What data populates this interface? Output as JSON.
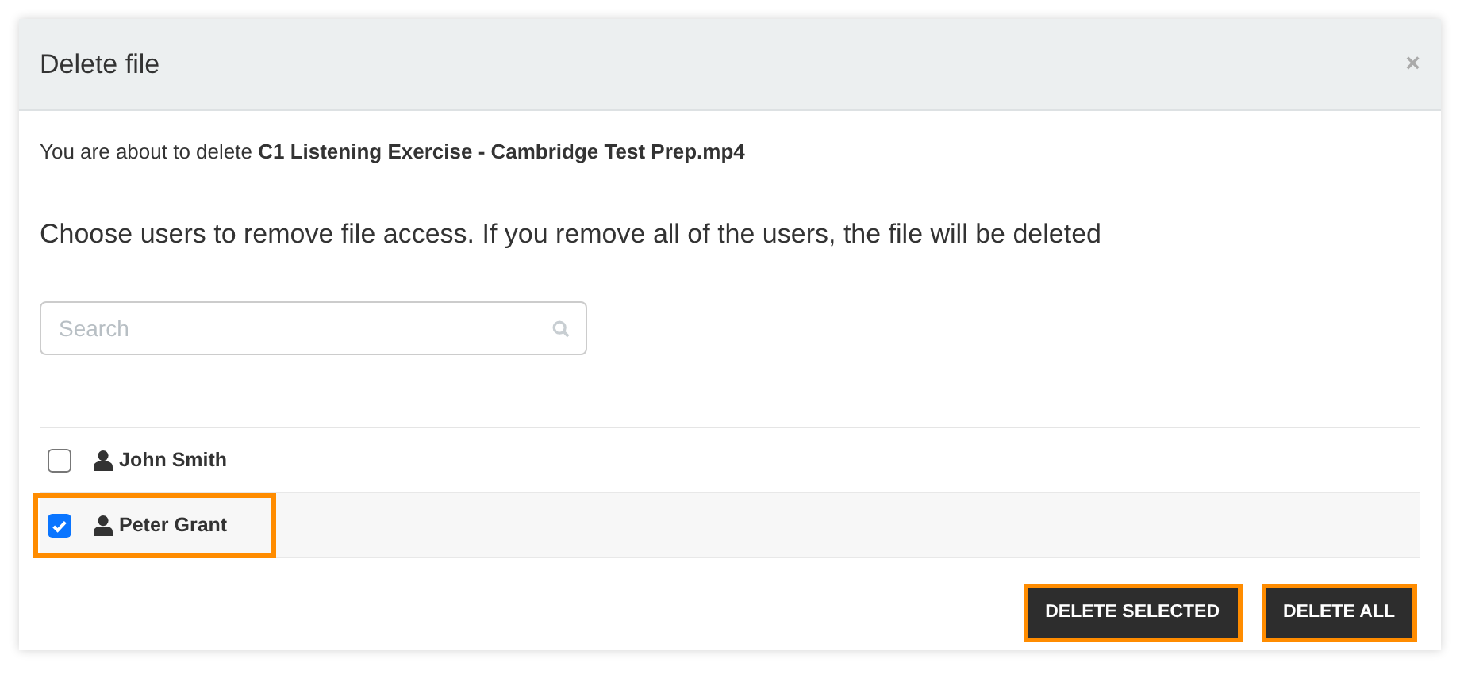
{
  "dialog": {
    "title": "Delete file",
    "close": "×"
  },
  "intro": "You are about to delete **C1 Listening Exercise - Cambridge Test Prep.mp4**",
  "instruction": "Choose users to remove file access. If you remove all of the users, the file will be deleted",
  "search": {
    "placeholder": "Search"
  },
  "users": [
    {
      "name": "John Smith",
      "checked": false,
      "highlighted": false
    },
    {
      "name": "Peter Grant",
      "checked": true,
      "highlighted": true
    }
  ],
  "buttons": [
    {
      "label": "DELETE SELECTED",
      "highlighted": true
    },
    {
      "label": "DELETE ALL",
      "highlighted": true
    }
  ]
}
